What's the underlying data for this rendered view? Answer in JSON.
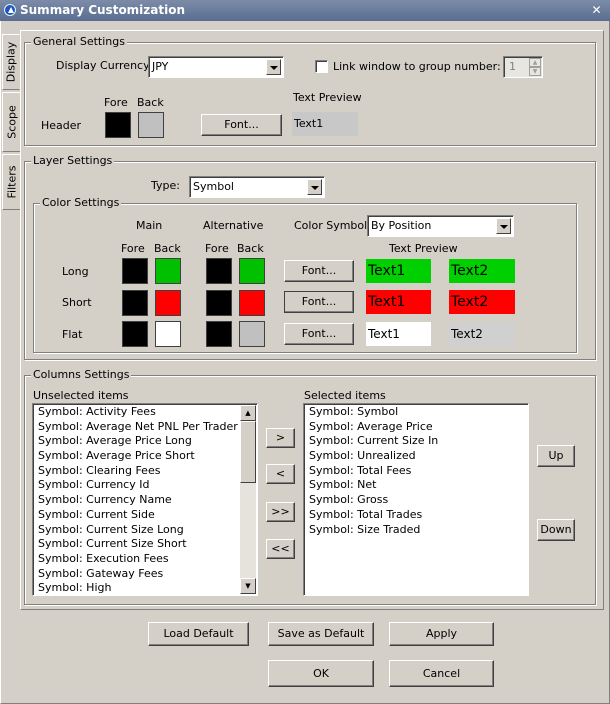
{
  "window": {
    "title": "Summary Customization",
    "close_glyph": "✕"
  },
  "tabs": [
    {
      "label": "Display"
    },
    {
      "label": "Scope"
    },
    {
      "label": "Filters"
    }
  ],
  "general": {
    "legend": "General Settings",
    "currency_label": "Display Currency:",
    "currency_value": "JPY",
    "link_label": "Link window to group number:",
    "link_checked": false,
    "group_number": "1",
    "header_label": "Header",
    "fore_label": "Fore",
    "back_label": "Back",
    "font_button": "Font...",
    "preview_label": "Text Preview",
    "preview_text": "Text1",
    "header_fore_color": "#000000",
    "header_back_color": "#c0c0c0"
  },
  "layer": {
    "legend": "Layer Settings",
    "type_label": "Type:",
    "type_value": "Symbol",
    "color_legend": "Color Settings",
    "main_label": "Main",
    "alt_label": "Alternative",
    "color_symbol_label": "Color Symbol:",
    "color_symbol_value": "By Position",
    "fore_label": "Fore",
    "back_label": "Back",
    "fore_label2": "Fore",
    "back_label2": "Back",
    "preview_label": "Text Preview",
    "rows": [
      {
        "label": "Long",
        "main_fore": "#000000",
        "main_back": "#00c000",
        "alt_fore": "#000000",
        "alt_back": "#00c000",
        "font_button": "Font...",
        "text1": "Text1",
        "text2": "Text2",
        "preview1_bg": "#00d000",
        "preview2_bg": "#00d000"
      },
      {
        "label": "Short",
        "main_fore": "#000000",
        "main_back": "#ff0000",
        "alt_fore": "#000000",
        "alt_back": "#ff0000",
        "font_button": "Font...",
        "text1": "Text1",
        "text2": "Text2",
        "preview1_bg": "#ff0000",
        "preview2_bg": "#ff0000"
      },
      {
        "label": "Flat",
        "main_fore": "#000000",
        "main_back": "#ffffff",
        "alt_fore": "#000000",
        "alt_back": "#c0c0c0",
        "font_button": "Font...",
        "text1": "Text1",
        "text2": "Text2",
        "preview1_bg": "#ffffff",
        "preview2_bg": "#d4d0c8"
      }
    ]
  },
  "columns": {
    "legend": "Columns Settings",
    "unselected_label": "Unselected items",
    "selected_label": "Selected items",
    "unselected": [
      "Symbol: Activity Fees",
      "Symbol: Average Net PNL Per Trader",
      "Symbol: Average Price Long",
      "Symbol: Average Price Short",
      "Symbol: Clearing Fees",
      "Symbol: Currency Id",
      "Symbol: Currency Name",
      "Symbol: Current Side",
      "Symbol: Current Size Long",
      "Symbol: Current Size Short",
      "Symbol: Execution Fees",
      "Symbol: Gateway Fees",
      "Symbol: High"
    ],
    "selected": [
      "Symbol: Symbol",
      "Symbol: Average Price",
      "Symbol: Current Size In",
      "Symbol: Unrealized",
      "Symbol: Total Fees",
      "Symbol: Net",
      "Symbol: Gross",
      "Symbol: Total Trades",
      "Symbol: Size Traded"
    ],
    "move_right": ">",
    "move_left": "<",
    "move_all_right": ">>",
    "move_all_left": "<<",
    "up": "Up",
    "down": "Down"
  },
  "footer": {
    "load_default": "Load Default",
    "save_default": "Save as Default",
    "apply": "Apply",
    "ok": "OK",
    "cancel": "Cancel"
  }
}
